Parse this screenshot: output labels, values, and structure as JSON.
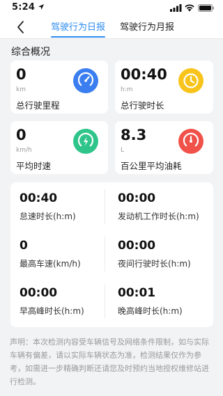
{
  "status_bar": {
    "time": "5:24"
  },
  "tabs": [
    {
      "label": "驾驶行为日报",
      "active": true
    },
    {
      "label": "驾驶行为月报",
      "active": false
    }
  ],
  "section_title": "综合概况",
  "summary_cards": [
    {
      "value": "0",
      "unit": "km",
      "label": "总行驶里程",
      "icon": "speedometer-icon",
      "color": "#3a7ef0"
    },
    {
      "value": "00:40",
      "unit": "h:m",
      "label": "总行驶时长",
      "icon": "clock-icon",
      "color": "#f8c41b"
    },
    {
      "value": "0",
      "unit": "km/h",
      "label": "平均时速",
      "icon": "gauge-bolt-icon",
      "color": "#2fc58a"
    },
    {
      "value": "8.3",
      "unit": "L",
      "label": "百公里平均油耗",
      "icon": "fuel-gauge-icon",
      "color": "#f0524a"
    }
  ],
  "details": [
    {
      "value": "00:40",
      "label": "怠速时长(h:m)"
    },
    {
      "value": "00:00",
      "label": "发动机工作时长(h:m)"
    },
    {
      "value": "0",
      "label": "最高车速(km/h)"
    },
    {
      "value": "00:00",
      "label": "夜间行驶时长(h:m)"
    },
    {
      "value": "00:00",
      "label": "早高峰时长(h:m)"
    },
    {
      "value": "00:01",
      "label": "晚高峰时长(h:m)"
    }
  ],
  "disclaimer": "声明：本次检测内容受车辆信号及网络条件限制，如与实际车辆有偏差，请以实际车辆状态为准，检测结果仅作为参考，如需进一步精确判断还请您及时预约当地授权维修站进行检测。"
}
